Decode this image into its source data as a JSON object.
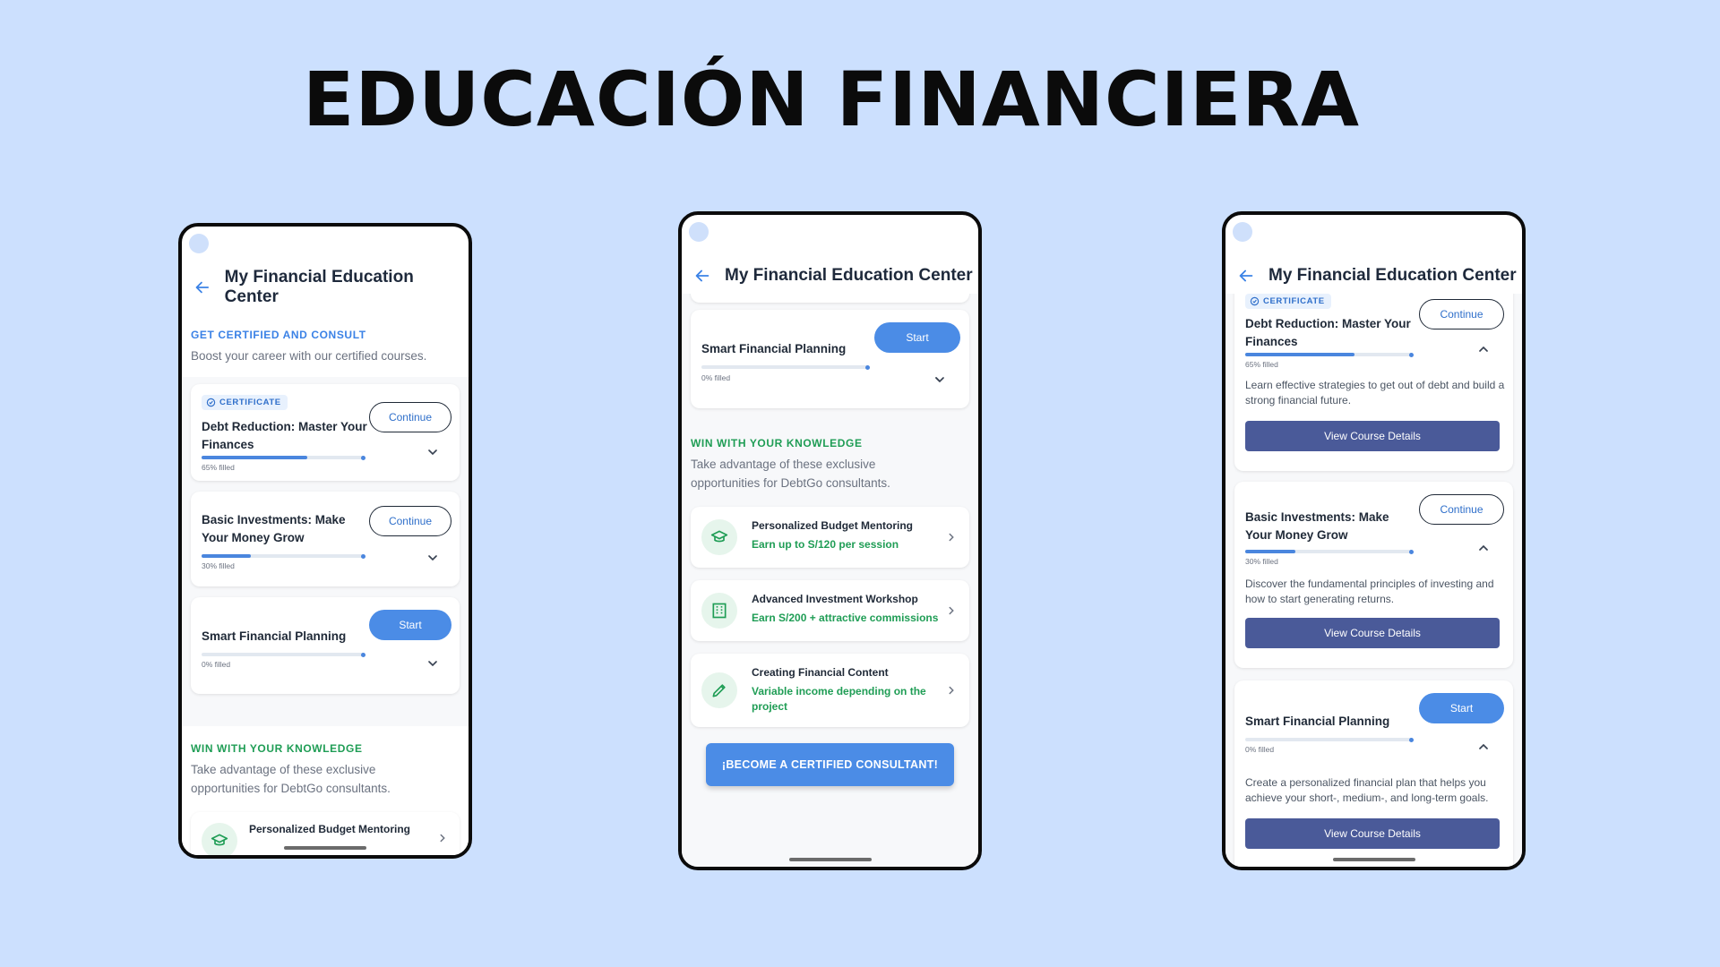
{
  "page_title": "EDUCACIÓN FINANCIERA",
  "app": {
    "header_title": "My Financial Education Center"
  },
  "sections": {
    "certify_label": "GET CERTIFIED AND CONSULT",
    "certify_desc": "Boost your career with our certified courses.",
    "win_label": "WIN WITH YOUR KNOWLEDGE",
    "win_desc": "Take advantage of these exclusive opportunities for DebtGo consultants."
  },
  "courses": [
    {
      "badge": "CERTIFICATE",
      "title": "Debt Reduction: Master Your Finances",
      "button": "Continue",
      "progress": 0.65,
      "progress_label": "65% filled",
      "description": "Learn effective strategies to get out of debt and build a strong financial future.",
      "details_button": "View Course Details"
    },
    {
      "title": "Basic Investments: Make Your Money Grow",
      "button": "Continue",
      "progress": 0.3,
      "progress_label": "30% filled",
      "description": "Discover the fundamental principles of investing and how to start generating returns.",
      "details_button": "View Course Details"
    },
    {
      "title": "Smart Financial Planning",
      "button": "Start",
      "progress": 0.0,
      "progress_label": "0% filled",
      "description": "Create a personalized financial plan that helps you achieve your short-, medium-, and long-term goals.",
      "details_button": "View Course Details"
    }
  ],
  "opportunities": [
    {
      "title": "Personalized Budget Mentoring",
      "subtitle": "Earn up to S/120 per session",
      "icon": "graduation-cap-icon"
    },
    {
      "title": "Advanced Investment Workshop",
      "subtitle": "Earn S/200 + attractive commissions",
      "icon": "building-icon"
    },
    {
      "title": "Creating Financial Content",
      "subtitle": "Variable income depending on the project",
      "icon": "pencil-icon"
    }
  ],
  "cta_label": "¡BECOME A CERTIFIED CONSULTANT!",
  "colors": {
    "background": "#cce0fe",
    "primary_blue": "#4b8ce6",
    "green": "#1f9d55",
    "details_button": "#4a5a99"
  }
}
